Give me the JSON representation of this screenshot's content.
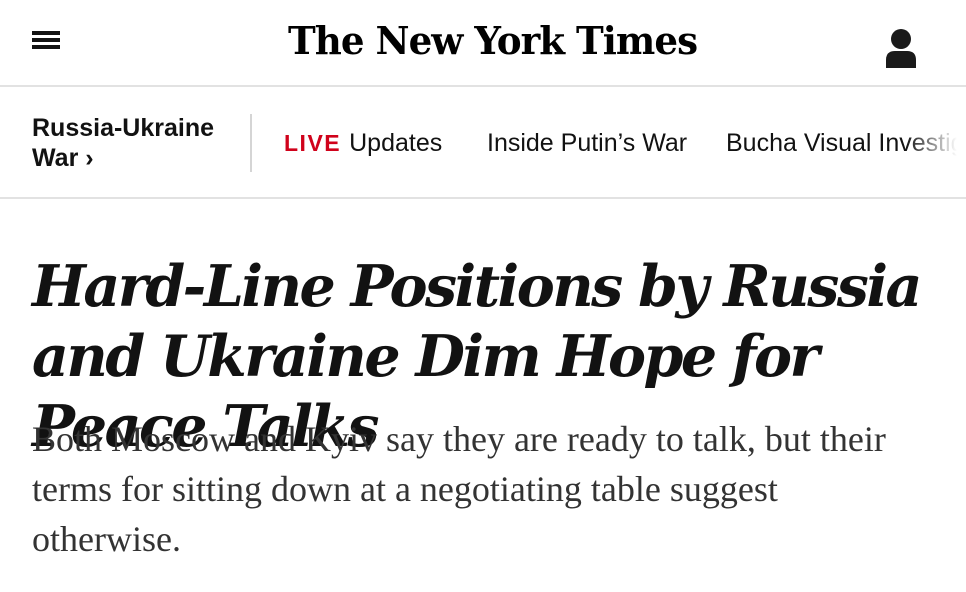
{
  "masthead": {
    "logo_text": "The New York Times",
    "menu_icon": "hamburger-menu-icon",
    "account_icon": "user-account-icon"
  },
  "section_nav": {
    "section_label": "Russia-Ukraine War ›",
    "live_tag": "LIVE",
    "items": [
      {
        "label": "Updates"
      },
      {
        "label": "Inside Putin’s War"
      },
      {
        "label": "Bucha Visual Investig"
      }
    ],
    "live_color": "#d0021b"
  },
  "article": {
    "headline": "Hard-Line Positions by Russia and Ukraine Dim Hope for Peace Talks",
    "summary": "Both Moscow and Kyiv say they are ready to talk, but their terms for sitting down at a negotiating table suggest otherwise."
  }
}
